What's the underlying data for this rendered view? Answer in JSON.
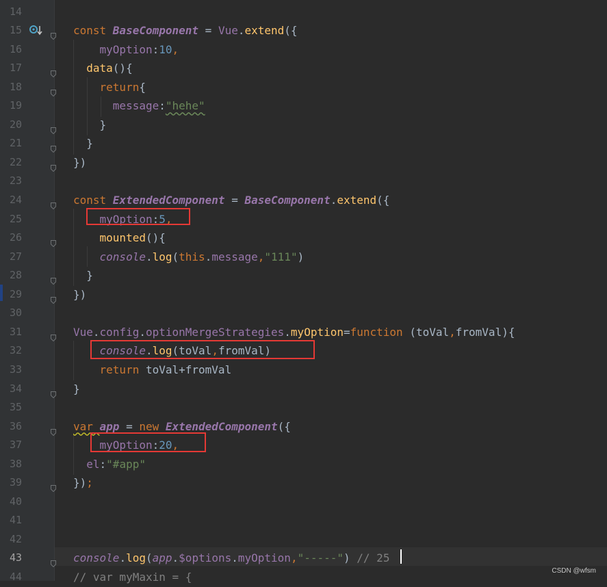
{
  "editor": {
    "lines": [
      {
        "no": "14",
        "tokens": []
      },
      {
        "no": "15",
        "tokens": [
          [
            "k",
            "const "
          ],
          [
            "c",
            "BaseComponent"
          ],
          [
            "t",
            " = "
          ],
          [
            "p",
            "Vue"
          ],
          [
            "t",
            "."
          ],
          [
            "f",
            "extend"
          ],
          [
            "t",
            "({"
          ]
        ]
      },
      {
        "no": "16",
        "tokens": [
          [
            "t",
            "    "
          ],
          [
            "p",
            "myOption"
          ],
          [
            "t",
            ":"
          ],
          [
            "n",
            "10"
          ],
          [
            "k",
            ","
          ]
        ]
      },
      {
        "no": "17",
        "tokens": [
          [
            "t",
            "  "
          ],
          [
            "f",
            "data"
          ],
          [
            "t",
            "(){"
          ]
        ]
      },
      {
        "no": "18",
        "tokens": [
          [
            "t",
            "    "
          ],
          [
            "k",
            "return"
          ],
          [
            "t",
            "{"
          ]
        ]
      },
      {
        "no": "19",
        "tokens": [
          [
            "t",
            "      "
          ],
          [
            "p",
            "message"
          ],
          [
            "t",
            ":"
          ],
          [
            "s",
            "\"hehe\""
          ]
        ]
      },
      {
        "no": "20",
        "tokens": [
          [
            "t",
            "    }"
          ]
        ]
      },
      {
        "no": "21",
        "tokens": [
          [
            "t",
            "  }"
          ]
        ]
      },
      {
        "no": "22",
        "tokens": [
          [
            "t",
            "})"
          ]
        ]
      },
      {
        "no": "23",
        "tokens": []
      },
      {
        "no": "24",
        "tokens": [
          [
            "k",
            "const "
          ],
          [
            "c",
            "ExtendedComponent"
          ],
          [
            "t",
            " = "
          ],
          [
            "c",
            "BaseComponent"
          ],
          [
            "t",
            "."
          ],
          [
            "f",
            "extend"
          ],
          [
            "t",
            "({"
          ]
        ]
      },
      {
        "no": "25",
        "tokens": [
          [
            "t",
            "    "
          ],
          [
            "p",
            "myOption"
          ],
          [
            "t",
            ":"
          ],
          [
            "n",
            "5"
          ],
          [
            "k",
            ","
          ]
        ]
      },
      {
        "no": "26",
        "tokens": [
          [
            "t",
            "    "
          ],
          [
            "f",
            "mounted"
          ],
          [
            "t",
            "(){"
          ]
        ]
      },
      {
        "no": "27",
        "tokens": [
          [
            "t",
            "    "
          ],
          [
            "c2",
            "console"
          ],
          [
            "t",
            "."
          ],
          [
            "f",
            "log"
          ],
          [
            "t",
            "("
          ],
          [
            "k",
            "this"
          ],
          [
            "t",
            "."
          ],
          [
            "p",
            "message"
          ],
          [
            "k",
            ","
          ],
          [
            "s",
            "\"111\""
          ],
          [
            "t",
            ")"
          ]
        ]
      },
      {
        "no": "28",
        "tokens": [
          [
            "t",
            "  }"
          ]
        ]
      },
      {
        "no": "29",
        "tokens": [
          [
            "t",
            "})"
          ]
        ]
      },
      {
        "no": "30",
        "tokens": []
      },
      {
        "no": "31",
        "tokens": [
          [
            "p",
            "Vue"
          ],
          [
            "t",
            "."
          ],
          [
            "p",
            "config"
          ],
          [
            "t",
            "."
          ],
          [
            "p",
            "optionMergeStrategies"
          ],
          [
            "t",
            "."
          ],
          [
            "f",
            "myOption"
          ],
          [
            "t",
            "="
          ],
          [
            "k",
            "function "
          ],
          [
            "t",
            "(toVal"
          ],
          [
            "k",
            ","
          ],
          [
            "t",
            "fromVal){"
          ]
        ]
      },
      {
        "no": "32",
        "tokens": [
          [
            "t",
            "    "
          ],
          [
            "c2",
            "console"
          ],
          [
            "t",
            "."
          ],
          [
            "f",
            "log"
          ],
          [
            "t",
            "(toVal"
          ],
          [
            "k",
            ","
          ],
          [
            "t",
            "fromVal)"
          ]
        ]
      },
      {
        "no": "33",
        "tokens": [
          [
            "t",
            "    "
          ],
          [
            "k",
            "return "
          ],
          [
            "t",
            "toVal+fromVal"
          ]
        ]
      },
      {
        "no": "34",
        "tokens": [
          [
            "t",
            "}"
          ]
        ]
      },
      {
        "no": "35",
        "tokens": []
      },
      {
        "no": "36",
        "tokens": [
          [
            "k",
            "var "
          ],
          [
            "c",
            "app"
          ],
          [
            "t",
            " = "
          ],
          [
            "k",
            "new "
          ],
          [
            "c",
            "ExtendedComponent"
          ],
          [
            "t",
            "({"
          ]
        ]
      },
      {
        "no": "37",
        "tokens": [
          [
            "t",
            "    "
          ],
          [
            "p",
            "myOption"
          ],
          [
            "t",
            ":"
          ],
          [
            "n",
            "20"
          ],
          [
            "k",
            ","
          ]
        ]
      },
      {
        "no": "38",
        "tokens": [
          [
            "t",
            "  "
          ],
          [
            "p",
            "el"
          ],
          [
            "t",
            ":"
          ],
          [
            "s",
            "\"#app\""
          ]
        ]
      },
      {
        "no": "39",
        "tokens": [
          [
            "t",
            "})"
          ],
          [
            "k",
            ";"
          ]
        ]
      },
      {
        "no": "40",
        "tokens": []
      },
      {
        "no": "41",
        "tokens": []
      },
      {
        "no": "42",
        "tokens": []
      },
      {
        "no": "43",
        "tokens": [
          [
            "c2",
            "console"
          ],
          [
            "t",
            "."
          ],
          [
            "f",
            "log"
          ],
          [
            "t",
            "("
          ],
          [
            "c2",
            "app"
          ],
          [
            "t",
            "."
          ],
          [
            "p",
            "$options"
          ],
          [
            "t",
            "."
          ],
          [
            "p",
            "myOption"
          ],
          [
            "k",
            ","
          ],
          [
            "s",
            "\"-----\""
          ],
          [
            "t",
            ") "
          ],
          [
            "cm",
            "// 25"
          ]
        ]
      },
      {
        "no": "44",
        "tokens": [
          [
            "cm",
            "// var myMaxin = {"
          ]
        ]
      }
    ],
    "fold_lines": [
      "15",
      "17",
      "18",
      "20",
      "21",
      "22",
      "24",
      "26",
      "28",
      "29",
      "31",
      "34",
      "36",
      "39",
      "43"
    ],
    "current_line": "43",
    "highlight_boxes": [
      "25",
      "32",
      "37"
    ]
  },
  "colors": {
    "background": "#2b2b2b",
    "gutter": "#313335",
    "keyword": "#cc7832",
    "constant": "#9876aa",
    "function": "#ffc66d",
    "number": "#6897bb",
    "string": "#6a8759",
    "comment": "#808080",
    "highlight_box": "#e53935"
  },
  "icons": {
    "gutter_icon": "override-marker-icon",
    "fold_icon": "fold-marker-icon"
  },
  "watermark": "CSDN @wfsm"
}
